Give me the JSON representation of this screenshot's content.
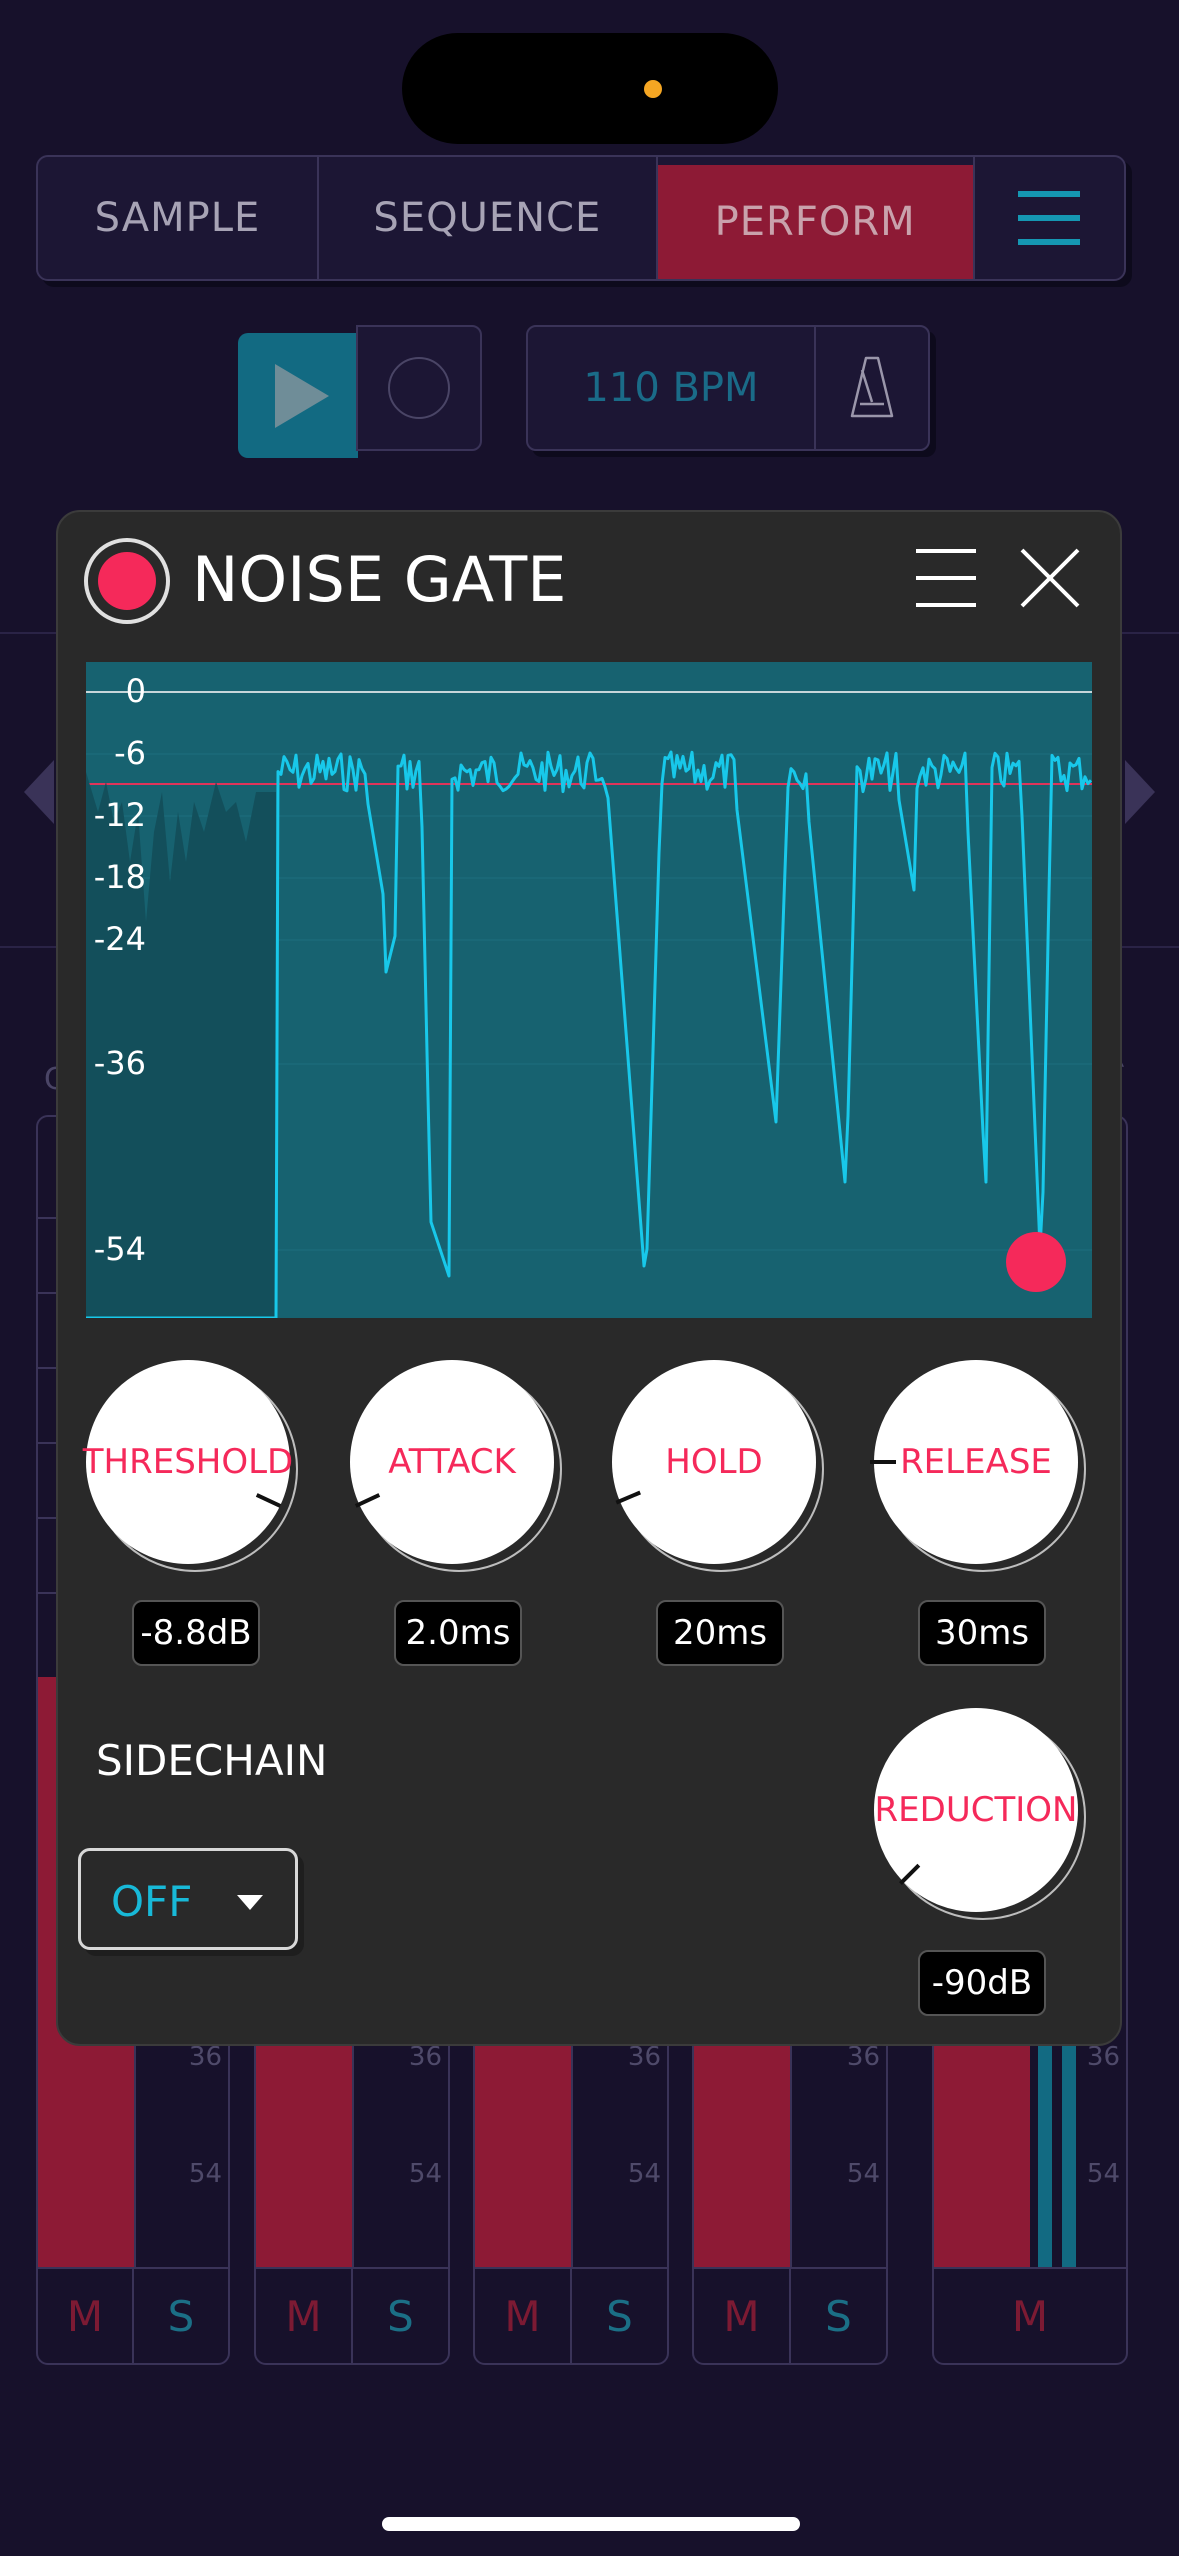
{
  "header": {
    "tabs": [
      {
        "label": "SAMPLE",
        "active": false
      },
      {
        "label": "SEQUENCE",
        "active": false
      },
      {
        "label": "PERFORM",
        "active": true
      }
    ],
    "menu_icon": "hamburger-icon"
  },
  "transport": {
    "play_icon": "play-icon",
    "record_icon": "record-icon",
    "bpm_label": "110 BPM",
    "metronome_icon": "metronome-icon"
  },
  "background_mixer": {
    "edge_left_text": "C",
    "edge_right_text": "R",
    "scale_labels": [
      "36",
      "54"
    ],
    "channels": [
      {
        "mute": "M",
        "solo": "S"
      },
      {
        "mute": "M",
        "solo": "S"
      },
      {
        "mute": "M",
        "solo": "S"
      },
      {
        "mute": "M",
        "solo": "S"
      },
      {
        "mute": "M",
        "solo": ""
      }
    ]
  },
  "panel": {
    "title": "NOISE GATE",
    "enabled": true,
    "icons": {
      "power": "power-toggle-icon",
      "menu": "menu-icon",
      "close": "close-icon"
    },
    "graph": {
      "db_labels": [
        "0",
        "-6",
        "-12",
        "-18",
        "-24",
        "-36",
        "-54"
      ],
      "threshold_db": -8.8,
      "record_icon": "record-dot-icon"
    },
    "knobs": [
      {
        "label": "THRESHOLD",
        "value": "-8.8dB",
        "angle_deg": 25
      },
      {
        "label": "ATTACK",
        "value": "2.0ms",
        "angle_deg": 155
      },
      {
        "label": "HOLD",
        "value": "20ms",
        "angle_deg": 157
      },
      {
        "label": "RELEASE",
        "value": "30ms",
        "angle_deg": 180
      }
    ],
    "sidechain": {
      "label": "SIDECHAIN",
      "value": "OFF",
      "caret_icon": "caret-down-icon"
    },
    "reduction": {
      "label": "REDUCTION",
      "value": "-90dB",
      "angle_deg": 135
    }
  },
  "colors": {
    "background": "#17112b",
    "accent_red": "#f5295a",
    "perform_tab": "#8d1a35",
    "waveform": "#18c8ea",
    "graph_bg": "#176270",
    "dropdown_text": "#18b9d8"
  }
}
